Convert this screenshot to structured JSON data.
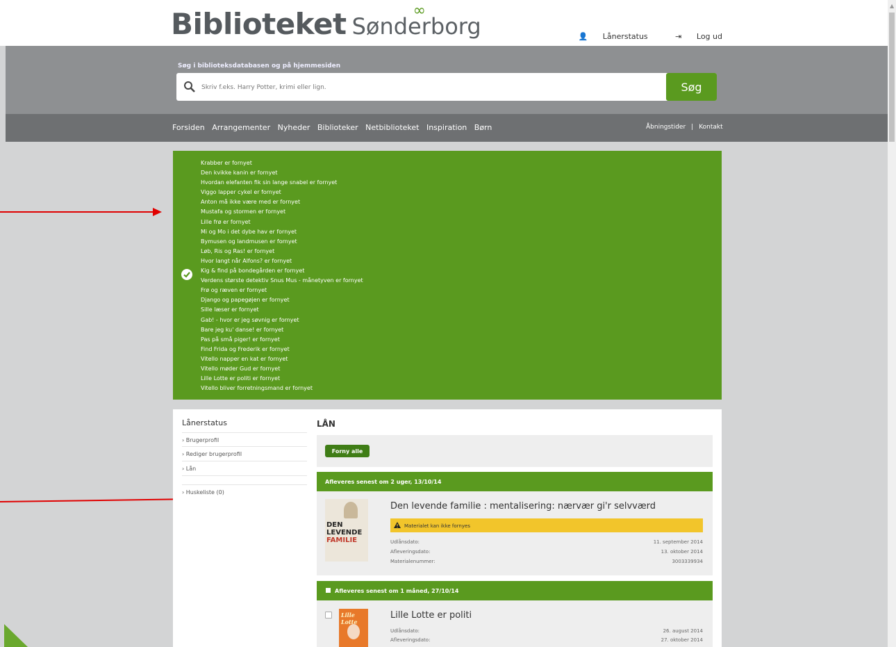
{
  "header": {
    "logo_main": "Biblioteket",
    "logo_sub": "Sønderborg",
    "logo_symbol": "∞",
    "laanerstatus_link": "Lånerstatus",
    "logud_link": "Log ud"
  },
  "search": {
    "label": "Søg i biblioteksdatabasen og på hjemmesiden",
    "placeholder": "Skriv f.eks. Harry Potter, krimi eller lign.",
    "button": "Søg"
  },
  "nav": {
    "items": [
      "Forsiden",
      "Arrangementer",
      "Nyheder",
      "Biblioteker",
      "Netbiblioteket",
      "Inspiration",
      "Børn"
    ],
    "right": [
      "Åbningstider",
      "Kontakt"
    ]
  },
  "renewal_messages": [
    "Krabber er fornyet",
    "Den kvikke kanin er fornyet",
    "Hvordan elefanten fik sin lange snabel er fornyet",
    "Viggo lapper cykel er fornyet",
    "Anton må ikke være med er fornyet",
    "Mustafa og stormen er fornyet",
    "Lille frø er fornyet",
    "Mi og Mo i det dybe hav er fornyet",
    "Bymusen og landmusen er fornyet",
    "Løb, Ris og Ras! er fornyet",
    "Hvor langt når Alfons? er fornyet",
    "Kig & find på bondegården er fornyet",
    "Verdens største detektiv Snus Mus - månetyven er fornyet",
    "Frø og ræven er fornyet",
    "Django og papegøjen er fornyet",
    "Sille læser er fornyet",
    "Gab! - hvor er jeg søvnig er fornyet",
    "Bare jeg ku' danse! er fornyet",
    "Pas på små piger! er fornyet",
    "Find Frida og Frederik er fornyet",
    "Vitello napper en kat er fornyet",
    "Vitello møder Gud er fornyet",
    "Lille Lotte er politi er fornyet",
    "Vitello bliver forretningsmand er fornyet"
  ],
  "sidebar": {
    "title": "Lånerstatus",
    "items": [
      "Brugerprofil",
      "Rediger brugerprofil",
      "Lån",
      "Huskeliste (0)"
    ]
  },
  "loans": {
    "title": "LÅN",
    "renew_all": "Forny alle",
    "groups": [
      {
        "due": "Afleveres senest om 2 uger, 13/10/14",
        "items": [
          {
            "title": "Den levende familie : mentalisering: nærvær gi'r selvværd",
            "cover": {
              "line1": "DEN",
              "line2": "LEVENDE",
              "line3": "FAMILIE"
            },
            "warning": "Materialet kan ikke fornyes",
            "fields": [
              {
                "k": "Udlånsdato:",
                "v": "11. september 2014"
              },
              {
                "k": "Afleveringsdato:",
                "v": "13. oktober 2014"
              },
              {
                "k": "Materialenummer:",
                "v": "3003339934"
              }
            ]
          }
        ]
      },
      {
        "due": "Afleveres senest om 1 måned, 27/10/14",
        "items": [
          {
            "title": "Lille Lotte er politi",
            "cover": {
              "line1": "Lille Lotte"
            },
            "fields": [
              {
                "k": "Udlånsdato:",
                "v": "26. august 2014"
              },
              {
                "k": "Afleveringsdato:",
                "v": "27. oktober 2014"
              }
            ]
          }
        ]
      }
    ]
  },
  "colors": {
    "brand_green": "#5a9a1f",
    "warning_yellow": "#f2c52b",
    "arrow_red": "#e00000"
  }
}
